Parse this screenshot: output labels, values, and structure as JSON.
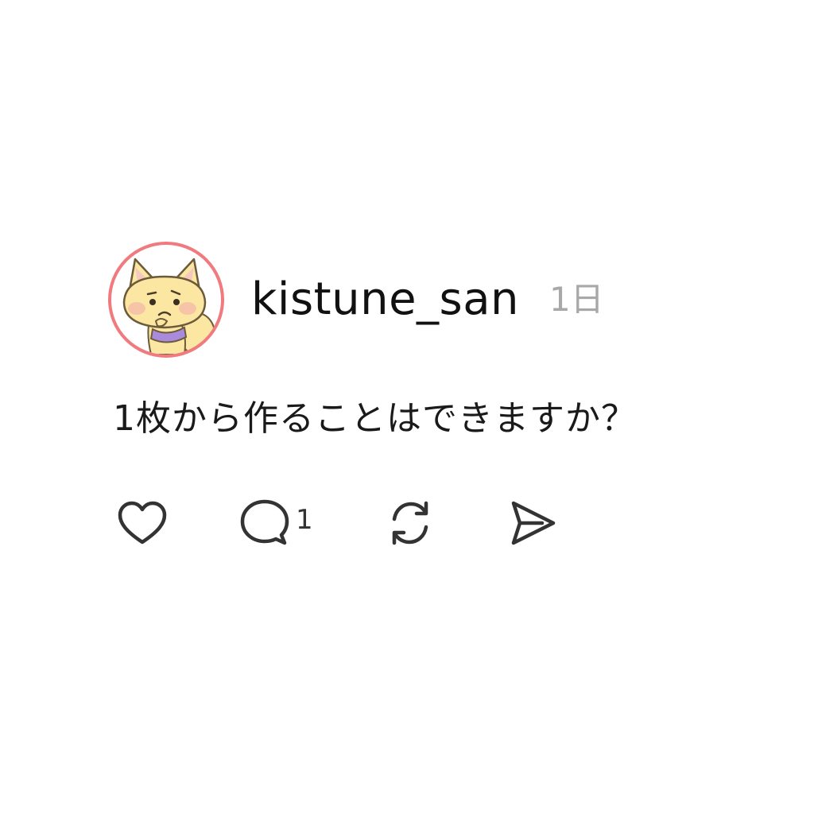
{
  "post": {
    "author": {
      "username": "kistune_san",
      "avatar_icon": "fox-avatar-icon"
    },
    "timestamp": "1日",
    "text": "1枚から作ることはできますか？",
    "actions": {
      "like_icon": "heart-icon",
      "reply_icon": "speech-bubble-icon",
      "reply_count": "1",
      "repost_icon": "repost-icon",
      "share_icon": "send-icon"
    }
  },
  "colors": {
    "avatar_ring": "#F07A7E",
    "timestamp": "#a8a8a8",
    "text": "#1a1a1a",
    "icon_stroke": "#333333"
  }
}
